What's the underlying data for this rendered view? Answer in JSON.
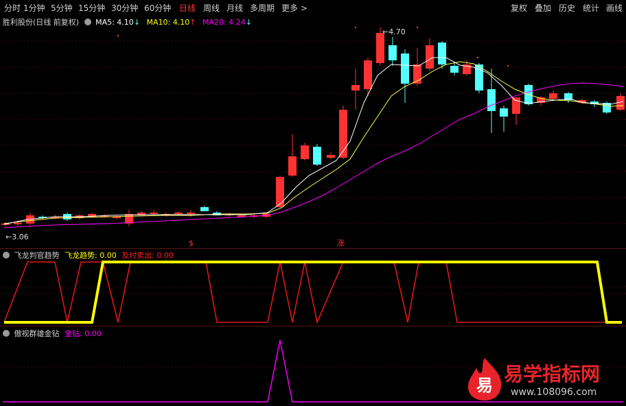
{
  "toolbar": {
    "periods": [
      "分时",
      "1分钟",
      "5分钟",
      "15分钟",
      "30分钟",
      "60分钟",
      "日线",
      "周线",
      "月线",
      "多周期",
      "更多 >"
    ],
    "active_period": "日线",
    "tools": [
      "复权",
      "叠加",
      "历史",
      "统计",
      "画线"
    ]
  },
  "main_chart": {
    "stock_title": "胜利股份(日线 前复权)",
    "ma5": {
      "label": "MA5: 4.10",
      "arrow": "↓",
      "color": "#ffffff"
    },
    "ma10": {
      "label": "MA10: 4.10",
      "arrow": "↑",
      "color": "#ffff00"
    },
    "ma20": {
      "label": "MA20: 4.24",
      "arrow": "↓",
      "color": "#ff00ff"
    },
    "high_label": "4.70",
    "low_label": "3.06",
    "marker_s": "$",
    "marker_zhang": "涨",
    "up_color": "#ff3232",
    "down_color": "#54ffff"
  },
  "indicator1": {
    "name": "飞龙判官趋势",
    "trend_label": "飞龙趋势: 0.00",
    "sell_label": "及时卖出: 0.00",
    "trend_color": "#ffff00",
    "sell_color": "#ff2020"
  },
  "indicator2": {
    "name": "傲视群雄金钻",
    "diamond_label": "金钻: 0.00",
    "color": "#ff00ff"
  },
  "watermark": {
    "logo_char": "易",
    "title": "易学指标网",
    "url": "www.108096.com"
  }
}
